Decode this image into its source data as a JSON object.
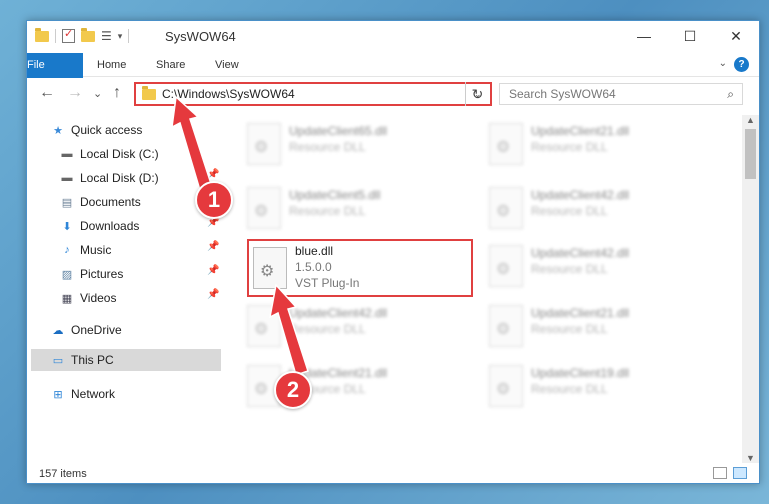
{
  "window": {
    "title": "SysWOW64",
    "controls": {
      "minimize": "—",
      "maximize": "☐",
      "close": "✕"
    }
  },
  "ribbon": {
    "tabs": [
      "File",
      "Home",
      "Share",
      "View"
    ],
    "help": "?",
    "collapse": "⌄"
  },
  "nav": {
    "back": "←",
    "forward": "→",
    "recent": "⌄",
    "up": "↑",
    "address": "C:\\Windows\\SysWOW64",
    "address_dropdown": "⌄",
    "refresh": "↻",
    "search_placeholder": "Search SysWOW64",
    "search_icon": "⌕"
  },
  "navpane": {
    "items": [
      {
        "label": "Quick access",
        "icon": "star-icon",
        "glyph": "★",
        "pinned": false
      },
      {
        "label": "Local Disk (C:)",
        "icon": "drive-icon",
        "glyph": "▬",
        "pinned": true
      },
      {
        "label": "Local Disk (D:)",
        "icon": "drive-icon",
        "glyph": "▬",
        "pinned": true
      },
      {
        "label": "Documents",
        "icon": "documents-icon",
        "glyph": "▤",
        "pinned": true
      },
      {
        "label": "Downloads",
        "icon": "downloads-icon",
        "glyph": "⬇",
        "pinned": true
      },
      {
        "label": "Music",
        "icon": "music-icon",
        "glyph": "♪",
        "pinned": true
      },
      {
        "label": "Pictures",
        "icon": "pictures-icon",
        "glyph": "▨",
        "pinned": true
      },
      {
        "label": "Videos",
        "icon": "videos-icon",
        "glyph": "▦",
        "pinned": true
      },
      {
        "label": "OneDrive",
        "icon": "cloud-icon",
        "glyph": "☁",
        "pinned": false
      },
      {
        "label": "This PC",
        "icon": "computer-icon",
        "glyph": "▭",
        "pinned": false
      },
      {
        "label": "Network",
        "icon": "network-icon",
        "glyph": "⊞",
        "pinned": false
      }
    ],
    "pin_glyph": "📌"
  },
  "files": {
    "left": [
      {
        "name": "UpdateClient65.dll",
        "sub": "Resource DLL"
      },
      {
        "name": "UpdateClient5.dll",
        "sub": "Resource DLL"
      },
      {
        "name": "blue.dll",
        "version": "1.5.0.0",
        "type": "VST Plug-In"
      },
      {
        "name": "UpdateClient42.dll",
        "sub": "Resource DLL"
      },
      {
        "name": "UpdateClient21.dll",
        "sub": "Resource DLL"
      }
    ],
    "right": [
      {
        "name": "UpdateClient21.dll",
        "sub": "Resource DLL"
      },
      {
        "name": "UpdateClient42.dll",
        "sub": "Resource DLL"
      },
      {
        "name": "UpdateClient42.dll",
        "sub": "Resource DLL"
      },
      {
        "name": "UpdateClient21.dll",
        "sub": "Resource DLL"
      },
      {
        "name": "UpdateClient19.dll",
        "sub": "Resource DLL"
      }
    ]
  },
  "status": {
    "count": "157 items"
  },
  "annotations": {
    "step1": "1",
    "step2": "2",
    "color": "#e5393d"
  }
}
